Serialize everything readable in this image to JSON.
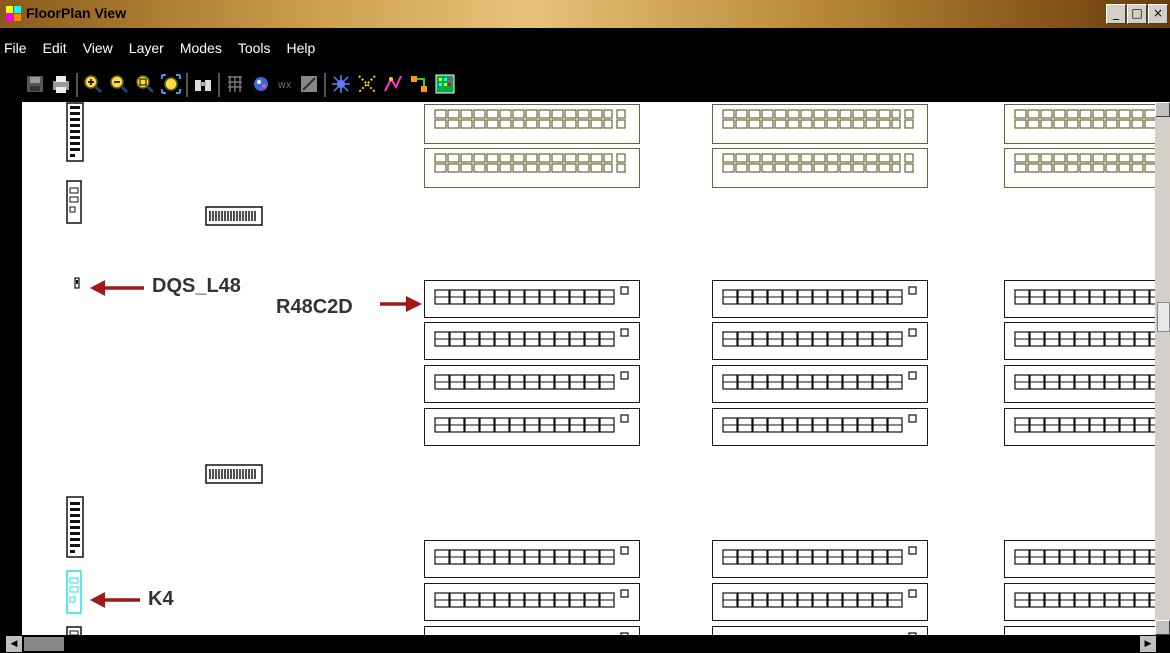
{
  "window": {
    "title": "FloorPlan View",
    "controls": [
      "_",
      "□",
      "×"
    ]
  },
  "menu": [
    "File",
    "Edit",
    "View",
    "Layer",
    "Modes",
    "Tools",
    "Help"
  ],
  "toolbar": {
    "buttons": [
      "save-icon",
      "print-icon",
      "zoom-in-icon",
      "zoom-out-icon",
      "zoom-area-icon",
      "zoom-fit-icon",
      "find-icon",
      "grid-icon",
      "color-icon",
      "ruler-icon",
      "select-icon",
      "star-icon",
      "net-icon",
      "graph-icon",
      "route-icon",
      "palette-icon"
    ]
  },
  "annotations": {
    "dqs": "DQS_L48",
    "row": "R48C2D",
    "k4": "K4"
  },
  "colors": {
    "arrow": "#a01818",
    "olive": "#6b6638",
    "highlight": "#22e0ee"
  }
}
